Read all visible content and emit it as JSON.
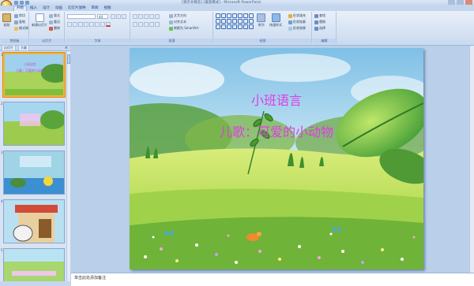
{
  "window": {
    "title": "[演示文稿名] [兼容模式] - Microsoft PowerPoint"
  },
  "tabs": [
    "开始",
    "插入",
    "设计",
    "动画",
    "幻灯片放映",
    "审阅",
    "视图"
  ],
  "ribbon": {
    "clipboard": {
      "paste": "粘贴",
      "cut": "剪切",
      "copy": "复制",
      "format_painter": "格式刷",
      "label": "剪贴板"
    },
    "slides": {
      "new_slide": "新建幻灯片",
      "layout": "版式",
      "reset": "重设",
      "delete": "删除",
      "label": "幻灯片"
    },
    "font": {
      "font_name": "",
      "font_size": "44",
      "label": "字体"
    },
    "paragraph": {
      "text_direction": "文字方向",
      "align_text": "对齐文本",
      "smartart": "转换为 SmartArt",
      "label": "段落"
    },
    "drawing": {
      "arrange": "排列",
      "quick_styles": "快速样式",
      "shape_fill": "形状填充",
      "shape_outline": "形状轮廓",
      "shape_effects": "形状效果",
      "label": "绘图"
    },
    "editing": {
      "find": "查找",
      "replace": "替换",
      "select": "选择",
      "label": "编辑"
    }
  },
  "panel": {
    "tab_slides": "幻灯片",
    "tab_outline": "大纲",
    "close": "×"
  },
  "thumbnails": [
    {
      "num": "1",
      "line1": "小班语言",
      "line2": "儿歌：可爱的小动物"
    },
    {
      "num": "2",
      "line1": "",
      "line2": ""
    },
    {
      "num": "3",
      "line1": "",
      "line2": ""
    },
    {
      "num": "4",
      "line1": "",
      "line2": ""
    },
    {
      "num": "5",
      "line1": "",
      "line2": ""
    }
  ],
  "slide": {
    "title": "小班语言",
    "subtitle": "儿歌：可爱的小动物"
  },
  "notes": {
    "placeholder": "单击此处添加备注"
  }
}
